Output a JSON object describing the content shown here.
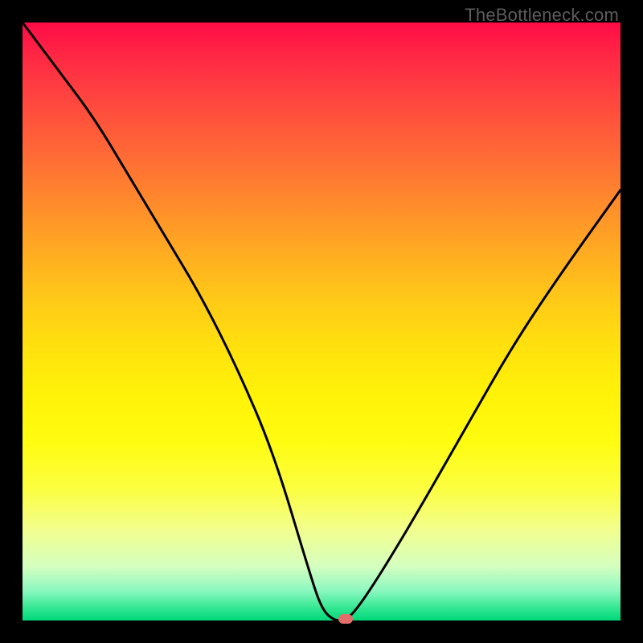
{
  "watermark": "TheBottleneck.com",
  "chart_data": {
    "type": "line",
    "title": "",
    "xlabel": "",
    "ylabel": "",
    "xlim": [
      0,
      100
    ],
    "ylim": [
      0,
      100
    ],
    "grid": false,
    "legend": false,
    "x": [
      0,
      6,
      12,
      18,
      24,
      30,
      36,
      42,
      48,
      50,
      52,
      54,
      56,
      60,
      66,
      74,
      82,
      90,
      100
    ],
    "values": [
      100,
      92,
      84,
      74,
      64,
      54,
      42,
      28,
      8,
      2,
      0,
      0,
      2,
      8,
      18,
      32,
      46,
      58,
      72
    ],
    "marker": {
      "x": 54,
      "y": 0
    }
  },
  "colors": {
    "frame": "#000000",
    "curve": "#000000",
    "marker": "#e26e6a",
    "gradient_top": "#ff0b46",
    "gradient_bottom": "#00d87a"
  }
}
